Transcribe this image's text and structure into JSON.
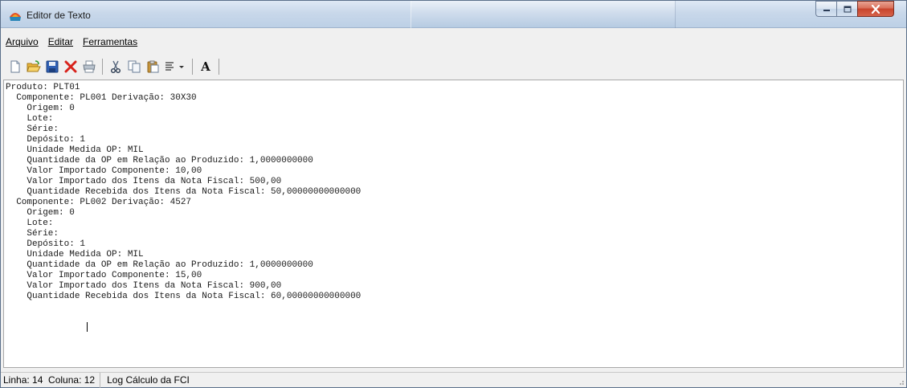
{
  "window": {
    "title": "Editor de Texto",
    "app_icon": "app-icon",
    "controls": [
      "minimize-icon",
      "maximize-icon",
      "close-icon"
    ]
  },
  "menu": {
    "items": [
      {
        "label": "Arquivo"
      },
      {
        "label": "Editar"
      },
      {
        "label": "Ferramentas"
      }
    ]
  },
  "toolbar": {
    "buttons": [
      {
        "name": "new-document-icon"
      },
      {
        "name": "open-folder-icon"
      },
      {
        "name": "save-icon"
      },
      {
        "name": "delete-icon"
      },
      {
        "name": "print-icon"
      },
      {
        "name": "cut-icon"
      },
      {
        "name": "copy-icon"
      },
      {
        "name": "paste-icon"
      },
      {
        "name": "align-dropdown-icon"
      },
      {
        "name": "font-icon"
      }
    ],
    "font_label": "A"
  },
  "editor": {
    "lines": [
      "Produto: PLT01",
      "  Componente: PL001 Derivação: 30X30",
      "    Origem: 0",
      "    Lote:",
      "    Série:",
      "    Depósito: 1",
      "    Unidade Medida OP: MIL",
      "    Quantidade da OP em Relação ao Produzido: 1,0000000000",
      "    Valor Importado Componente: 10,00",
      "    Valor Importado dos Itens da Nota Fiscal: 500,00",
      "    Quantidade Recebida dos Itens da Nota Fiscal: 50,00000000000000",
      "  Componente: PL002 Derivação: 4527",
      "    Origem: 0",
      "    Lote:",
      "    Série:",
      "    Depósito: 1",
      "    Unidade Medida OP: MIL",
      "    Quantidade da OP em Relação ao Produzido: 1,0000000000",
      "    Valor Importado Componente: 15,00",
      "    Valor Importado dos Itens da Nota Fiscal: 900,00",
      "    Quantidade Recebida dos Itens da Nota Fiscal: 60,00000000000000"
    ]
  },
  "status": {
    "position": "Linha: 14  Coluna: 12",
    "log": "Log Cálculo da FCI"
  }
}
